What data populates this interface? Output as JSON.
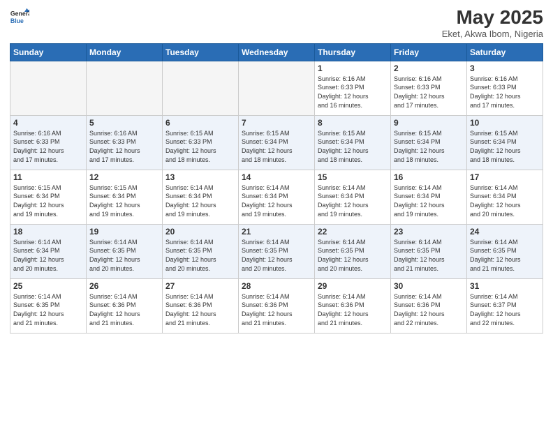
{
  "header": {
    "logo_general": "General",
    "logo_blue": "Blue",
    "title": "May 2025",
    "subtitle": "Eket, Akwa Ibom, Nigeria"
  },
  "weekdays": [
    "Sunday",
    "Monday",
    "Tuesday",
    "Wednesday",
    "Thursday",
    "Friday",
    "Saturday"
  ],
  "weeks": [
    [
      {
        "day": "",
        "info": ""
      },
      {
        "day": "",
        "info": ""
      },
      {
        "day": "",
        "info": ""
      },
      {
        "day": "",
        "info": ""
      },
      {
        "day": "1",
        "info": "Sunrise: 6:16 AM\nSunset: 6:33 PM\nDaylight: 12 hours\nand 16 minutes."
      },
      {
        "day": "2",
        "info": "Sunrise: 6:16 AM\nSunset: 6:33 PM\nDaylight: 12 hours\nand 17 minutes."
      },
      {
        "day": "3",
        "info": "Sunrise: 6:16 AM\nSunset: 6:33 PM\nDaylight: 12 hours\nand 17 minutes."
      }
    ],
    [
      {
        "day": "4",
        "info": "Sunrise: 6:16 AM\nSunset: 6:33 PM\nDaylight: 12 hours\nand 17 minutes."
      },
      {
        "day": "5",
        "info": "Sunrise: 6:16 AM\nSunset: 6:33 PM\nDaylight: 12 hours\nand 17 minutes."
      },
      {
        "day": "6",
        "info": "Sunrise: 6:15 AM\nSunset: 6:33 PM\nDaylight: 12 hours\nand 18 minutes."
      },
      {
        "day": "7",
        "info": "Sunrise: 6:15 AM\nSunset: 6:34 PM\nDaylight: 12 hours\nand 18 minutes."
      },
      {
        "day": "8",
        "info": "Sunrise: 6:15 AM\nSunset: 6:34 PM\nDaylight: 12 hours\nand 18 minutes."
      },
      {
        "day": "9",
        "info": "Sunrise: 6:15 AM\nSunset: 6:34 PM\nDaylight: 12 hours\nand 18 minutes."
      },
      {
        "day": "10",
        "info": "Sunrise: 6:15 AM\nSunset: 6:34 PM\nDaylight: 12 hours\nand 18 minutes."
      }
    ],
    [
      {
        "day": "11",
        "info": "Sunrise: 6:15 AM\nSunset: 6:34 PM\nDaylight: 12 hours\nand 19 minutes."
      },
      {
        "day": "12",
        "info": "Sunrise: 6:15 AM\nSunset: 6:34 PM\nDaylight: 12 hours\nand 19 minutes."
      },
      {
        "day": "13",
        "info": "Sunrise: 6:14 AM\nSunset: 6:34 PM\nDaylight: 12 hours\nand 19 minutes."
      },
      {
        "day": "14",
        "info": "Sunrise: 6:14 AM\nSunset: 6:34 PM\nDaylight: 12 hours\nand 19 minutes."
      },
      {
        "day": "15",
        "info": "Sunrise: 6:14 AM\nSunset: 6:34 PM\nDaylight: 12 hours\nand 19 minutes."
      },
      {
        "day": "16",
        "info": "Sunrise: 6:14 AM\nSunset: 6:34 PM\nDaylight: 12 hours\nand 19 minutes."
      },
      {
        "day": "17",
        "info": "Sunrise: 6:14 AM\nSunset: 6:34 PM\nDaylight: 12 hours\nand 20 minutes."
      }
    ],
    [
      {
        "day": "18",
        "info": "Sunrise: 6:14 AM\nSunset: 6:34 PM\nDaylight: 12 hours\nand 20 minutes."
      },
      {
        "day": "19",
        "info": "Sunrise: 6:14 AM\nSunset: 6:35 PM\nDaylight: 12 hours\nand 20 minutes."
      },
      {
        "day": "20",
        "info": "Sunrise: 6:14 AM\nSunset: 6:35 PM\nDaylight: 12 hours\nand 20 minutes."
      },
      {
        "day": "21",
        "info": "Sunrise: 6:14 AM\nSunset: 6:35 PM\nDaylight: 12 hours\nand 20 minutes."
      },
      {
        "day": "22",
        "info": "Sunrise: 6:14 AM\nSunset: 6:35 PM\nDaylight: 12 hours\nand 20 minutes."
      },
      {
        "day": "23",
        "info": "Sunrise: 6:14 AM\nSunset: 6:35 PM\nDaylight: 12 hours\nand 21 minutes."
      },
      {
        "day": "24",
        "info": "Sunrise: 6:14 AM\nSunset: 6:35 PM\nDaylight: 12 hours\nand 21 minutes."
      }
    ],
    [
      {
        "day": "25",
        "info": "Sunrise: 6:14 AM\nSunset: 6:35 PM\nDaylight: 12 hours\nand 21 minutes."
      },
      {
        "day": "26",
        "info": "Sunrise: 6:14 AM\nSunset: 6:36 PM\nDaylight: 12 hours\nand 21 minutes."
      },
      {
        "day": "27",
        "info": "Sunrise: 6:14 AM\nSunset: 6:36 PM\nDaylight: 12 hours\nand 21 minutes."
      },
      {
        "day": "28",
        "info": "Sunrise: 6:14 AM\nSunset: 6:36 PM\nDaylight: 12 hours\nand 21 minutes."
      },
      {
        "day": "29",
        "info": "Sunrise: 6:14 AM\nSunset: 6:36 PM\nDaylight: 12 hours\nand 21 minutes."
      },
      {
        "day": "30",
        "info": "Sunrise: 6:14 AM\nSunset: 6:36 PM\nDaylight: 12 hours\nand 22 minutes."
      },
      {
        "day": "31",
        "info": "Sunrise: 6:14 AM\nSunset: 6:37 PM\nDaylight: 12 hours\nand 22 minutes."
      }
    ]
  ]
}
